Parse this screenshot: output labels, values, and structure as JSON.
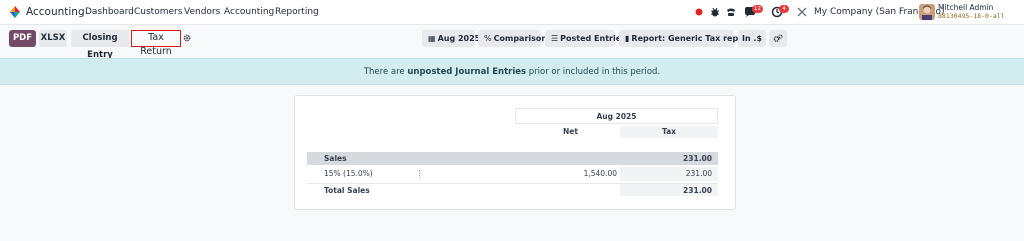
{
  "navbar": {
    "app_name": "Accounting",
    "menu": [
      "Dashboard",
      "Customers",
      "Vendors",
      "Accounting",
      "Reporting"
    ],
    "messages_badge": "12",
    "activities_badge": "4",
    "company": "My Company (San Francisco)",
    "user_name": "Mitchell Admin",
    "db_name": "88130495-18-0-all"
  },
  "control_panel": {
    "pdf_label": "PDF",
    "xlsx_label": "XLSX",
    "closing_entry_label": "Closing Entry",
    "breadcrumb": "Tax Return",
    "filters": {
      "date": "Aug 2025",
      "comparison": "Comparison",
      "entries": "Posted Entries",
      "report": "Report: Generic Tax report",
      "currency": "In .$"
    }
  },
  "alert": {
    "prefix": "There are ",
    "link": "unposted Journal Entries",
    "suffix": " prior or included in this period."
  },
  "report": {
    "period": "Aug 2025",
    "columns": [
      "Net",
      "Tax"
    ],
    "sales": {
      "label": "Sales",
      "net": "",
      "tax": "231.00"
    },
    "line": {
      "label": "15% (15.0%)",
      "net": "1,540.00",
      "tax": "231.00"
    },
    "total": {
      "label": "Total Sales",
      "net": "",
      "tax": "231.00"
    }
  },
  "colors": {
    "brand": "#714b67",
    "alert_bg": "#d3ecef",
    "highlight_border": "#d91c1c"
  }
}
